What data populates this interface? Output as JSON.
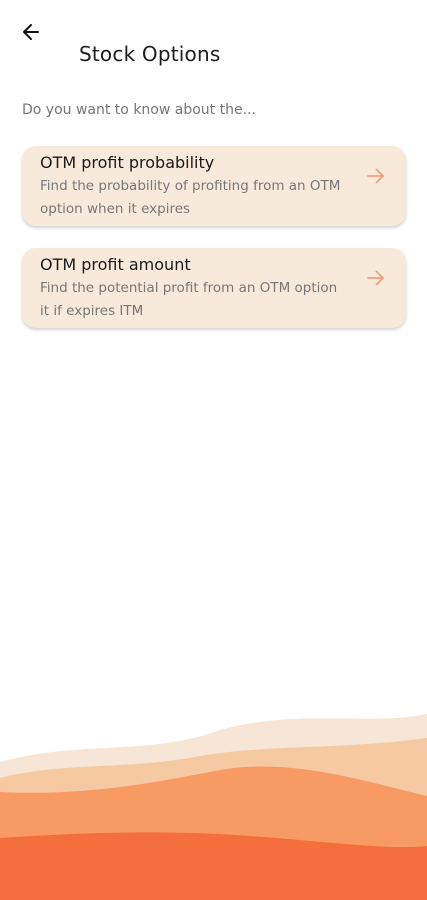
{
  "header": {
    "title": "Stock Options"
  },
  "prompt": "Do you want to know about the...",
  "cards": [
    {
      "title": "OTM profit probability",
      "description": "Find the probability of profiting from an OTM option when it expires"
    },
    {
      "title": "OTM profit amount",
      "description": "Find the potential profit from an OTM option it if expires ITM"
    }
  ],
  "colors": {
    "card_bg": "#f8eadb",
    "arrow": "#f0a07e",
    "wave_light": "#f7e6d5",
    "wave_mid": "#f5c9a2",
    "wave_orange": "#f79a63",
    "wave_dark": "#f46f3d"
  }
}
